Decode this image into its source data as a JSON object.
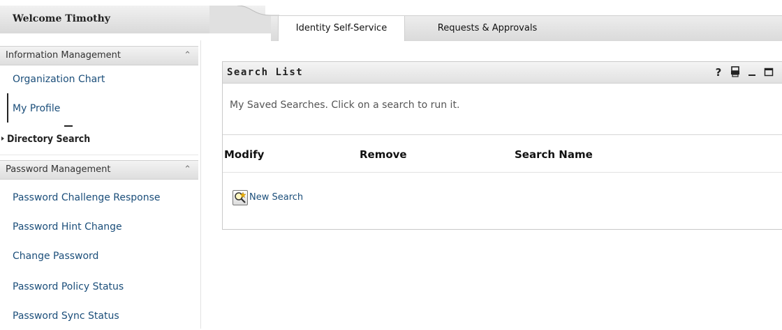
{
  "header": {
    "welcome": "Welcome Timothy",
    "tabs": [
      {
        "label": "Identity Self-Service",
        "active": true
      },
      {
        "label": "Requests & Approvals",
        "active": false
      }
    ]
  },
  "sidebar": {
    "sections": [
      {
        "title": "Information Management",
        "items": [
          {
            "label": "Organization Chart"
          },
          {
            "label": "My Profile"
          },
          {
            "label": "Directory Search",
            "selected": true
          }
        ]
      },
      {
        "title": "Password Management",
        "items": [
          {
            "label": "Password Challenge Response"
          },
          {
            "label": "Password Hint Change"
          },
          {
            "label": "Change Password"
          },
          {
            "label": "Password Policy Status"
          },
          {
            "label": "Password Sync Status"
          }
        ]
      }
    ],
    "collapse_icon": "double-chevron-up-icon"
  },
  "panel": {
    "title": "Search List",
    "tools": [
      "help-icon",
      "print-icon",
      "minimize-icon",
      "maximize-icon"
    ],
    "help_glyph": "?",
    "subtitle": "My Saved Searches. Click on a search to run it.",
    "columns": [
      "Modify",
      "Remove",
      "Search Name"
    ],
    "new_search_label": "New Search"
  },
  "colors": {
    "link": "#1b4e7a",
    "header_gradient_top": "#f1f1f1",
    "header_gradient_bottom": "#d9d9d9"
  }
}
